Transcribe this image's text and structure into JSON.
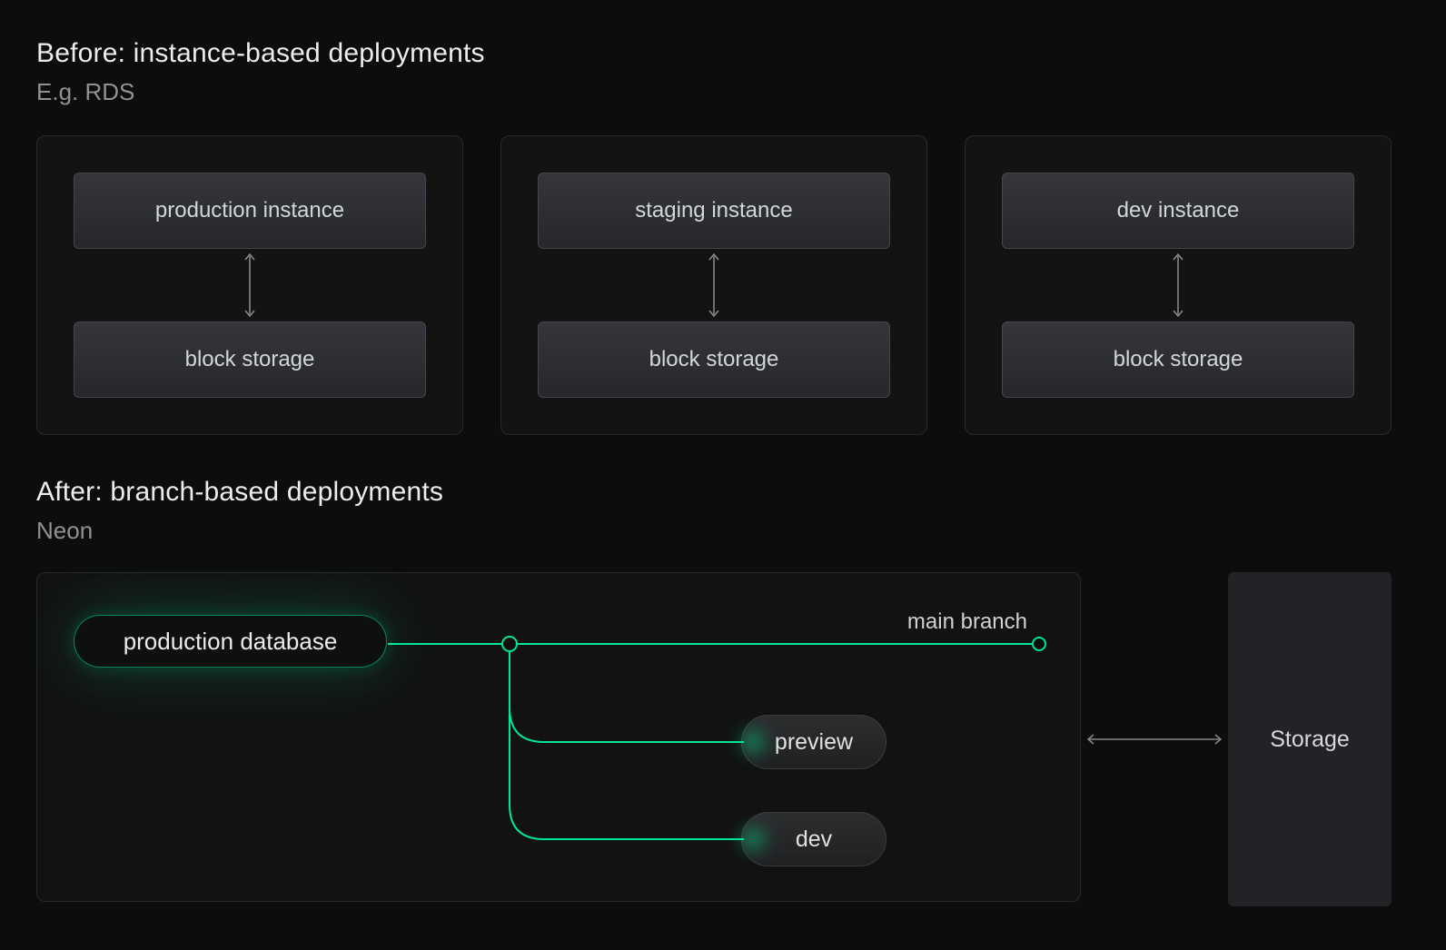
{
  "before": {
    "title": "Before: instance-based deployments",
    "subtitle": "E.g. RDS",
    "cards": [
      {
        "instance_label": "production instance",
        "storage_label": "block storage"
      },
      {
        "instance_label": "staging instance",
        "storage_label": "block storage"
      },
      {
        "instance_label": "dev instance",
        "storage_label": "block storage"
      }
    ]
  },
  "after": {
    "title": "After: branch-based deployments",
    "subtitle": "Neon",
    "database_label": "production database",
    "main_branch_label": "main branch",
    "branches": [
      {
        "label": "preview"
      },
      {
        "label": "dev"
      }
    ],
    "storage_label": "Storage"
  },
  "colors": {
    "background": "#0d0d0d",
    "accent_green": "#00e599",
    "arrow_gray": "#8b8f93"
  }
}
